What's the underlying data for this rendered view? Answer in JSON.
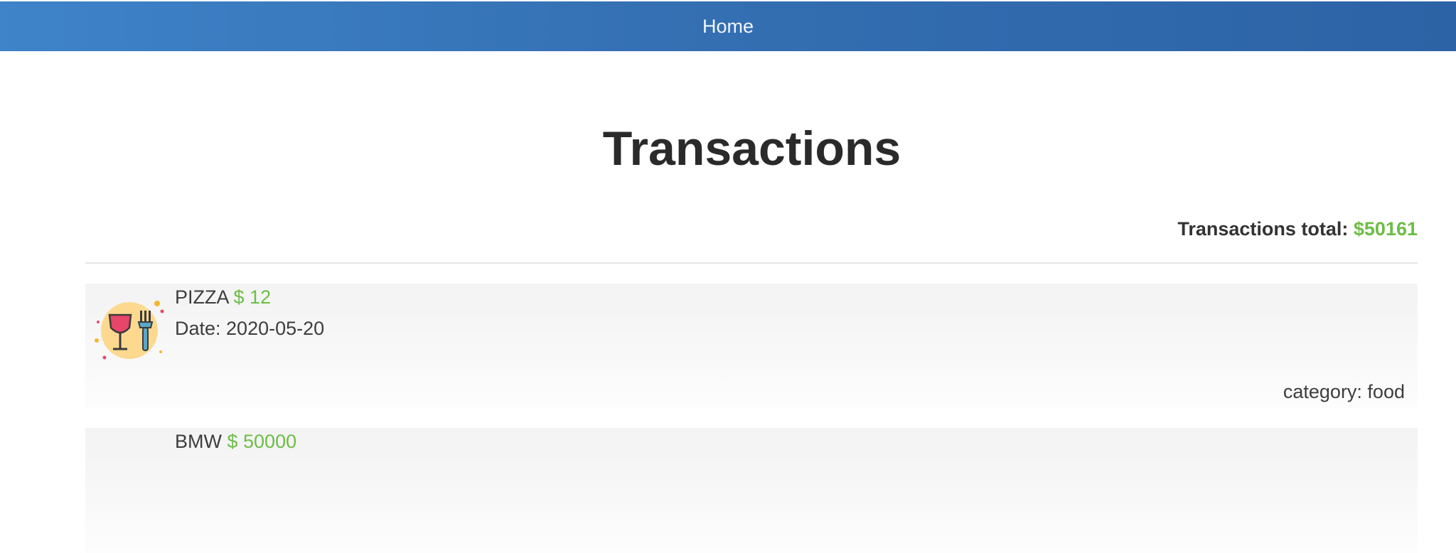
{
  "nav": {
    "home_label": "Home"
  },
  "page": {
    "title": "Transactions"
  },
  "summary": {
    "label": "Transactions total:",
    "amount": "$50161"
  },
  "transactions": [
    {
      "name": "PIZZA",
      "amount": "$ 12",
      "date": "Date: 2020-05-20",
      "category": "category: food",
      "icon": "food-wine-fork-icon"
    },
    {
      "name": "BMW",
      "amount": "$ 50000",
      "date": "",
      "category": "",
      "icon": ""
    }
  ],
  "colors": {
    "navbar": "#3470b3",
    "accent_green": "#6cbd45",
    "card_bg": "#f5f5f5"
  }
}
